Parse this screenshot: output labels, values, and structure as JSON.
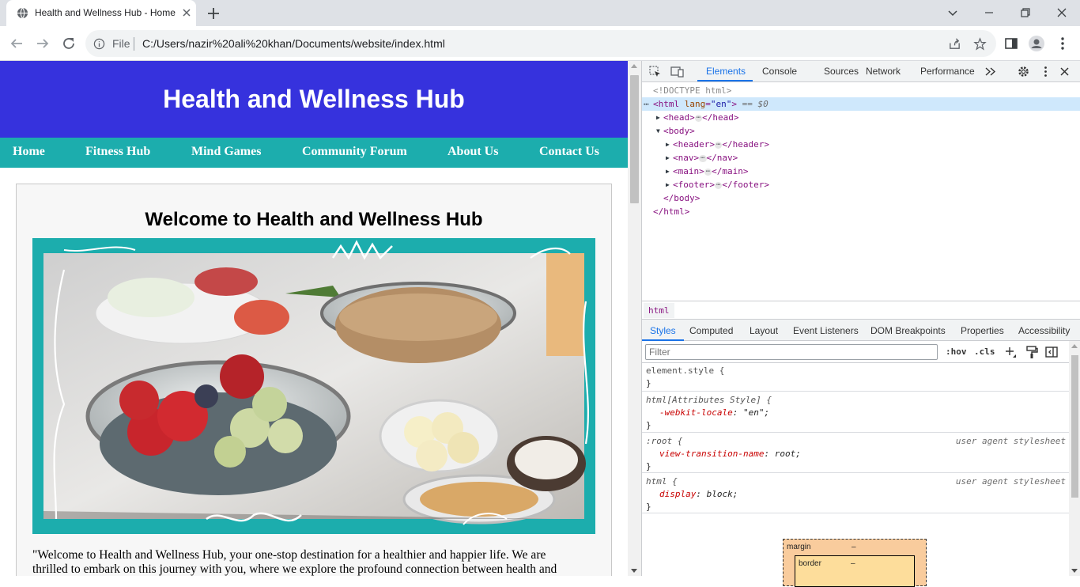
{
  "browser": {
    "tab_title": "Health and Wellness Hub - Home",
    "scheme_label": "File",
    "url": "C:/Users/nazir%20ali%20khan/Documents/website/index.html"
  },
  "site": {
    "header_title": "Health and Wellness Hub",
    "nav": [
      "Home",
      "Fitness Hub",
      "Mind Games",
      "Community Forum",
      "About Us",
      "Contact Us"
    ],
    "welcome_heading": "Welcome to Health and Wellness Hub",
    "intro_line1": "\"Welcome to Health and Wellness Hub, your one-stop destination for a healthier and happier life. We are",
    "intro_line2": "thrilled to embark on this journey with you, where we explore the profound connection between health and",
    "colors": {
      "header": "#3632dd",
      "nav": "#1cadad"
    }
  },
  "devtools": {
    "tabs": [
      "Elements",
      "Console",
      "Sources",
      "Network",
      "Performance"
    ],
    "dom": {
      "doctype": "<!DOCTYPE html>",
      "html_open_tag": "<html",
      "html_attr_name": "lang",
      "html_attr_value": "\"en\"",
      "html_open_close": ">",
      "selected_marker": "== $0",
      "head": "<head>",
      "head_close": "</head>",
      "body": "<body>",
      "header": "<header>",
      "header_close": "</header>",
      "nav": "<nav>",
      "nav_close": "</nav>",
      "main": "<main>",
      "main_close": "</main>",
      "footer": "<footer>",
      "footer_close": "</footer>",
      "body_close": "</body>",
      "html_close": "</html>"
    },
    "breadcrumb": "html",
    "sub_tabs": [
      "Styles",
      "Computed",
      "Layout",
      "Event Listeners",
      "DOM Breakpoints",
      "Properties",
      "Accessibility"
    ],
    "filter_placeholder": "Filter",
    "hov": ":hov",
    "cls": ".cls",
    "rules": {
      "element_style": "element.style {",
      "close": "}",
      "attr_style_selector": "html[Attributes Style] {",
      "attr_style_prop": "-webkit-locale",
      "attr_style_val": "\"en\";",
      "root_selector": ":root {",
      "root_prop": "view-transition-name",
      "root_val": "root;",
      "html_selector": "html {",
      "html_prop": "display",
      "html_val": "block;",
      "ua_label": "user agent stylesheet",
      "colon": ": "
    },
    "box_model": {
      "margin_label": "margin",
      "border_label": "border",
      "dash": "–"
    }
  }
}
